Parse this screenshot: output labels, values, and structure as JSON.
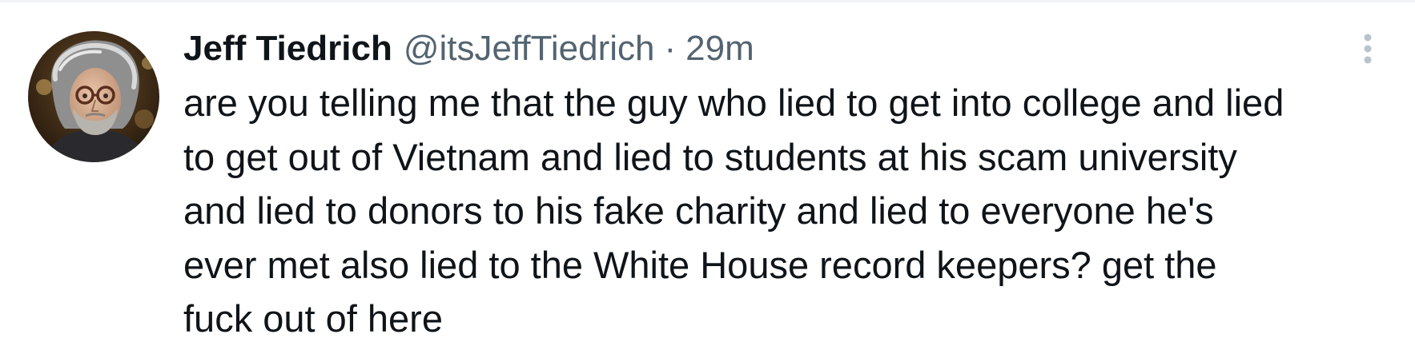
{
  "tweet": {
    "author": {
      "display_name": "Jeff Tiedrich",
      "handle": "@itsJeffTiedrich",
      "avatar_icon": "profile-photo-man-with-gray-hair-and-glasses"
    },
    "separator": "·",
    "timestamp": "29m",
    "more_icon": "vertical-ellipsis-icon",
    "text_lines": [
      "are you telling me that the guy who lied to get into college and lied",
      "to get out of Vietnam and lied to students at his scam university",
      "and lied to donors to his fake charity and lied to everyone he's",
      "ever met also lied to the White House record keepers? get the",
      "fuck out of here"
    ]
  },
  "colors": {
    "text_primary": "#0f1419",
    "text_secondary": "#536471",
    "divider": "#eff3f4",
    "icon": "#b9c3cc"
  }
}
